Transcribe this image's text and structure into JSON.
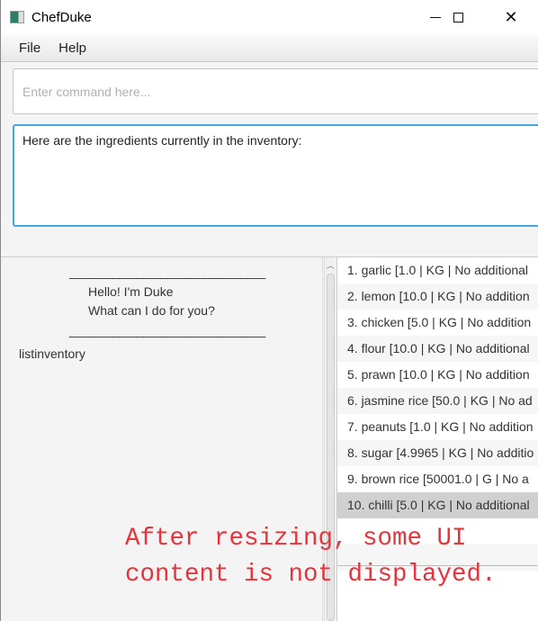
{
  "window": {
    "title": "ChefDuke"
  },
  "menu": [
    "File",
    "Help"
  ],
  "command": {
    "placeholder": "Enter command here...",
    "value": ""
  },
  "response": "Here are the ingredients currently in the inventory:",
  "dialog": {
    "divider": "________________________________",
    "greeting1": "Hello! I'm Duke",
    "greeting2": "What can I do for you?",
    "user_command": "listinventory"
  },
  "inventory": [
    "1. garlic [1.0 | KG | No additional",
    "2. lemon [10.0 | KG | No addition",
    "3. chicken [5.0 | KG | No addition",
    "4. flour [10.0 | KG | No additional",
    "5. prawn [10.0 | KG | No addition",
    "6. jasmine rice [50.0 | KG | No ad",
    "7. peanuts [1.0 | KG | No addition",
    "8. sugar [4.9965 | KG | No additio",
    "9. brown rice [50001.0 | G | No a",
    "10. chilli [5.0 | KG | No additional"
  ],
  "selected_index": 9,
  "annotation": {
    "line1": "After resizing, some UI",
    "line2": "content is not displayed."
  },
  "colors": {
    "focus": "#3fa9e0",
    "annotation": "#e8333a"
  }
}
